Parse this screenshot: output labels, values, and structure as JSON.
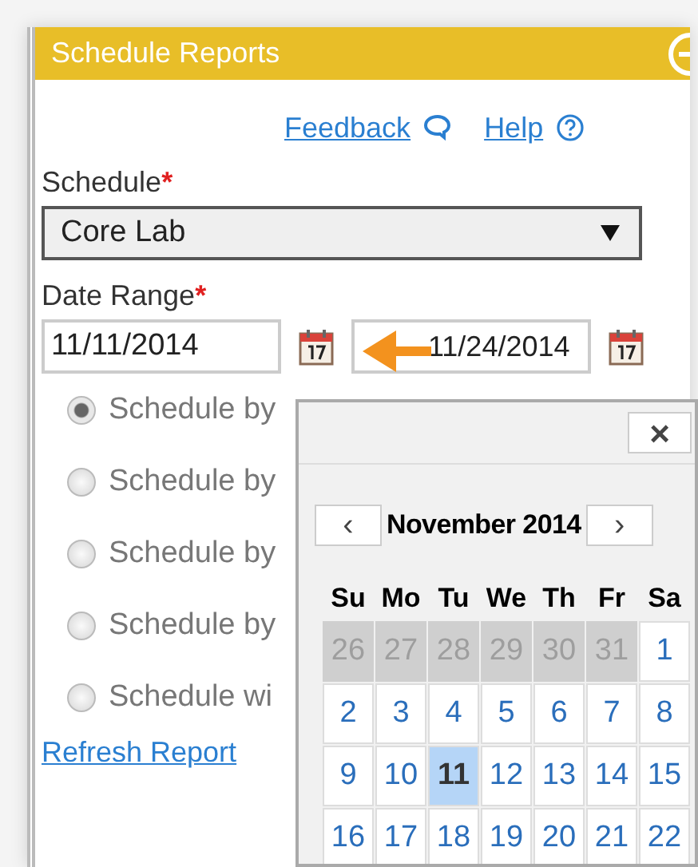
{
  "panel": {
    "title": "Schedule Reports",
    "links": [
      "Feedback",
      "Help"
    ],
    "schedule": {
      "label": "Schedule",
      "required": true,
      "required_mark": "*",
      "value": "Core Lab"
    },
    "date_range": {
      "label": "Date Range",
      "required": true,
      "required_mark": "*",
      "start": "11/11/2014",
      "end": "11/24/2014"
    },
    "options": [
      {
        "label": "Schedule by",
        "selected": true
      },
      {
        "label": "Schedule by",
        "selected": false
      },
      {
        "label": "Schedule by",
        "selected": false
      },
      {
        "label": "Schedule by",
        "selected": false
      },
      {
        "label": "Schedule wi",
        "selected": false
      }
    ],
    "refresh_link": "Refresh Report"
  },
  "date_picker": {
    "close": "×",
    "prev": "‹",
    "next": "›",
    "month": "November 2014",
    "weekdays": [
      "Su",
      "Mo",
      "Tu",
      "We",
      "Th",
      "Fr",
      "Sa"
    ],
    "weeks": [
      [
        {
          "day": "26",
          "other_month": true,
          "selected": false
        },
        {
          "day": "27",
          "other_month": true,
          "selected": false
        },
        {
          "day": "28",
          "other_month": true,
          "selected": false
        },
        {
          "day": "29",
          "other_month": true,
          "selected": false
        },
        {
          "day": "30",
          "other_month": true,
          "selected": false
        },
        {
          "day": "31",
          "other_month": true,
          "selected": false
        },
        {
          "day": "1",
          "other_month": false,
          "selected": false
        }
      ],
      [
        {
          "day": "2",
          "other_month": false,
          "selected": false
        },
        {
          "day": "3",
          "other_month": false,
          "selected": false
        },
        {
          "day": "4",
          "other_month": false,
          "selected": false
        },
        {
          "day": "5",
          "other_month": false,
          "selected": false
        },
        {
          "day": "6",
          "other_month": false,
          "selected": false
        },
        {
          "day": "7",
          "other_month": false,
          "selected": false
        },
        {
          "day": "8",
          "other_month": false,
          "selected": false
        }
      ],
      [
        {
          "day": "9",
          "other_month": false,
          "selected": false
        },
        {
          "day": "10",
          "other_month": false,
          "selected": false
        },
        {
          "day": "11",
          "other_month": false,
          "selected": true
        },
        {
          "day": "12",
          "other_month": false,
          "selected": false
        },
        {
          "day": "13",
          "other_month": false,
          "selected": false
        },
        {
          "day": "14",
          "other_month": false,
          "selected": false
        },
        {
          "day": "15",
          "other_month": false,
          "selected": false
        }
      ],
      [
        {
          "day": "16",
          "other_month": false,
          "selected": false
        },
        {
          "day": "17",
          "other_month": false,
          "selected": false
        },
        {
          "day": "18",
          "other_month": false,
          "selected": false
        },
        {
          "day": "19",
          "other_month": false,
          "selected": false
        },
        {
          "day": "20",
          "other_month": false,
          "selected": false
        },
        {
          "day": "21",
          "other_month": false,
          "selected": false
        },
        {
          "day": "22",
          "other_month": false,
          "selected": false
        }
      ]
    ]
  }
}
